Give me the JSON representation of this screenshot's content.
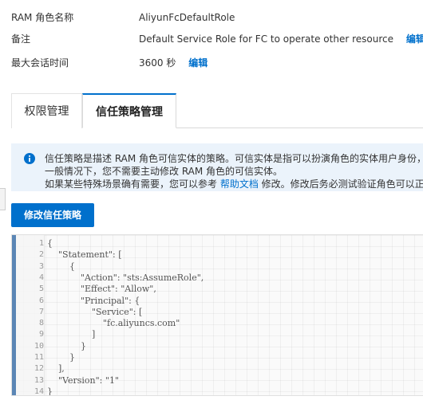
{
  "details": {
    "role_name_label": "RAM 角色名称",
    "role_name_value": "AliyunFcDefaultRole",
    "note_label": "备注",
    "note_value": "Default Service Role for FC to operate other resource",
    "note_edit": "编辑",
    "session_label": "最大会话时间",
    "session_value": "3600 秒",
    "session_edit": "编辑"
  },
  "tabs": [
    {
      "label": "权限管理",
      "active": false
    },
    {
      "label": "信任策略管理",
      "active": true
    }
  ],
  "notice": {
    "icon": "info-circle-icon",
    "line1": "信任策略是描述 RAM 角色可信实体的策略。可信实体是指可以扮演角色的实体用户身份，",
    "line2": "一般情况下，您不需要主动修改 RAM 角色的可信实体。",
    "line3_before": "如果某些特殊场景确有需要，您可以参考 ",
    "line3_link": "帮助文档",
    "line3_after": " 修改。修改后务必测试验证角色可以正常"
  },
  "modify_button": "修改信任策略",
  "editor": {
    "lines": [
      {
        "no": "1",
        "text": "{"
      },
      {
        "no": "2",
        "text": "    \"Statement\": ["
      },
      {
        "no": "3",
        "text": "        {"
      },
      {
        "no": "4",
        "text": "            \"Action\": \"sts:AssumeRole\","
      },
      {
        "no": "5",
        "text": "            \"Effect\": \"Allow\","
      },
      {
        "no": "6",
        "text": "            \"Principal\": {"
      },
      {
        "no": "7",
        "text": "                \"Service\": ["
      },
      {
        "no": "8",
        "text": "                    \"fc.aliyuncs.com\""
      },
      {
        "no": "9",
        "text": "                ]"
      },
      {
        "no": "10",
        "text": "            }"
      },
      {
        "no": "11",
        "text": "        }"
      },
      {
        "no": "12",
        "text": "    ],"
      },
      {
        "no": "13",
        "text": "    \"Version\": \"1\""
      },
      {
        "no": "14",
        "text": "}"
      }
    ]
  },
  "colors": {
    "accent": "#0070cc",
    "notice_bg": "#ebf3fb",
    "gutter_bar": "#5b86b5"
  }
}
